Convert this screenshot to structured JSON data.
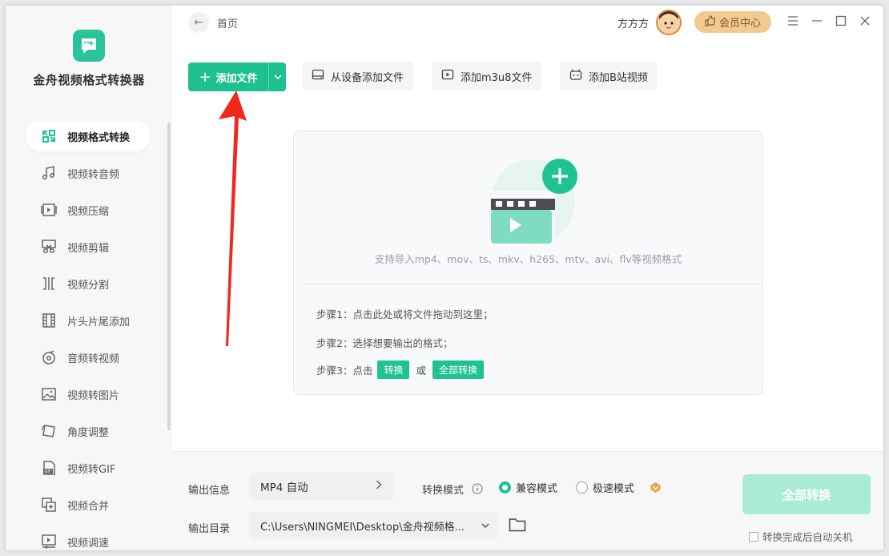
{
  "app": {
    "name": "金舟视频格式转换器"
  },
  "sidebar": {
    "items": [
      {
        "label": "视频格式转换",
        "icon": "convert-icon",
        "active": true
      },
      {
        "label": "视频转音频",
        "icon": "music-icon",
        "active": false
      },
      {
        "label": "视频压缩",
        "icon": "compress-icon",
        "active": false
      },
      {
        "label": "视频剪辑",
        "icon": "scissors-icon",
        "active": false
      },
      {
        "label": "视频分割",
        "icon": "split-icon",
        "active": false
      },
      {
        "label": "片头片尾添加",
        "icon": "film-icon",
        "active": false
      },
      {
        "label": "音频转视频",
        "icon": "disc-icon",
        "active": false
      },
      {
        "label": "视频转图片",
        "icon": "image-icon",
        "active": false
      },
      {
        "label": "角度调整",
        "icon": "rotate-icon",
        "active": false
      },
      {
        "label": "视频转GIF",
        "icon": "gif-icon",
        "active": false
      },
      {
        "label": "视频合并",
        "icon": "merge-icon",
        "active": false
      },
      {
        "label": "视频调速",
        "icon": "speed-icon",
        "active": false
      }
    ]
  },
  "header": {
    "breadcrumb": "首页",
    "username": "方方方",
    "vip_label": "会员中心"
  },
  "toolbar": {
    "add_file": "添加文件",
    "add_from_device": "从设备添加文件",
    "add_m3u8": "添加m3u8文件",
    "add_bilibili": "添加B站视频"
  },
  "drop_area": {
    "support_text": "支持导入mp4、mov、ts、mkv、h265、mtv、avi、flv等视频格式",
    "step1": "步骤1：点击此处或将文件拖动到这里；",
    "step2": "步骤2：选择想要输出的格式；",
    "step3_prefix": "步骤3：点击",
    "step3_btn1": "转换",
    "step3_or": "或",
    "step3_btn2": "全部转换"
  },
  "bottom": {
    "output_info_label": "输出信息",
    "output_format": "MP4 自动",
    "mode_label": "转换模式",
    "mode_compat": "兼容模式",
    "mode_fast": "极速模式",
    "selected_mode": "兼容模式",
    "output_dir_label": "输出目录",
    "output_dir": "C:\\Users\\NINGMEI\\Desktop\\金舟视频格...",
    "convert_all": "全部转换",
    "auto_shutdown": "转换完成后自动关机"
  },
  "colors": {
    "accent": "#1fc08f",
    "vip": "#f0c993",
    "arrow": "#f0281e"
  }
}
